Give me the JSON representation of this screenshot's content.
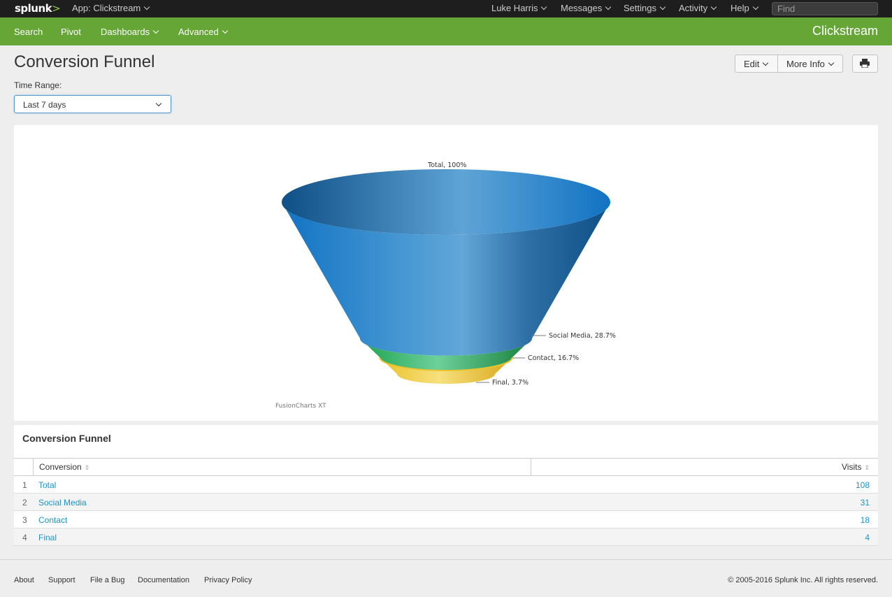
{
  "topbar": {
    "logo": "splunk",
    "logo_mark": ">",
    "app_menu": "App: Clickstream",
    "user": "Luke Harris",
    "messages": "Messages",
    "settings": "Settings",
    "activity": "Activity",
    "help": "Help",
    "find_placeholder": "Find"
  },
  "appbar": {
    "search": "Search",
    "pivot": "Pivot",
    "dashboards": "Dashboards",
    "advanced": "Advanced",
    "app_title": "Clickstream"
  },
  "page": {
    "title": "Conversion Funnel",
    "edit": "Edit",
    "more_info": "More Info",
    "time_range_label": "Time Range:",
    "time_range_value": "Last 7 days"
  },
  "chart_data": {
    "type": "funnel",
    "credit": "FusionCharts XT",
    "stages": [
      {
        "label": "Total, 100%",
        "name": "Total",
        "percent": 100,
        "color": "#2f7fbf"
      },
      {
        "label": "Social Media, 28.7%",
        "name": "Social Media",
        "percent": 28.7,
        "color": "#3cb878"
      },
      {
        "label": "Contact, 16.7%",
        "name": "Contact",
        "percent": 16.7,
        "color": "#f0cf3c"
      },
      {
        "label": "Final, 3.7%",
        "name": "Final",
        "percent": 3.7,
        "color": "#f0cf3c"
      }
    ]
  },
  "table": {
    "title": "Conversion Funnel",
    "columns": [
      "Conversion",
      "Visits"
    ],
    "rows": [
      {
        "index": "1",
        "conversion": "Total",
        "visits": "108"
      },
      {
        "index": "2",
        "conversion": "Social Media",
        "visits": "31"
      },
      {
        "index": "3",
        "conversion": "Contact",
        "visits": "18"
      },
      {
        "index": "4",
        "conversion": "Final",
        "visits": "4"
      }
    ]
  },
  "footer": {
    "about": "About",
    "support": "Support",
    "file_bug": "File a Bug",
    "documentation": "Documentation",
    "privacy": "Privacy Policy",
    "copyright": "© 2005-2016 Splunk Inc. All rights reserved."
  }
}
